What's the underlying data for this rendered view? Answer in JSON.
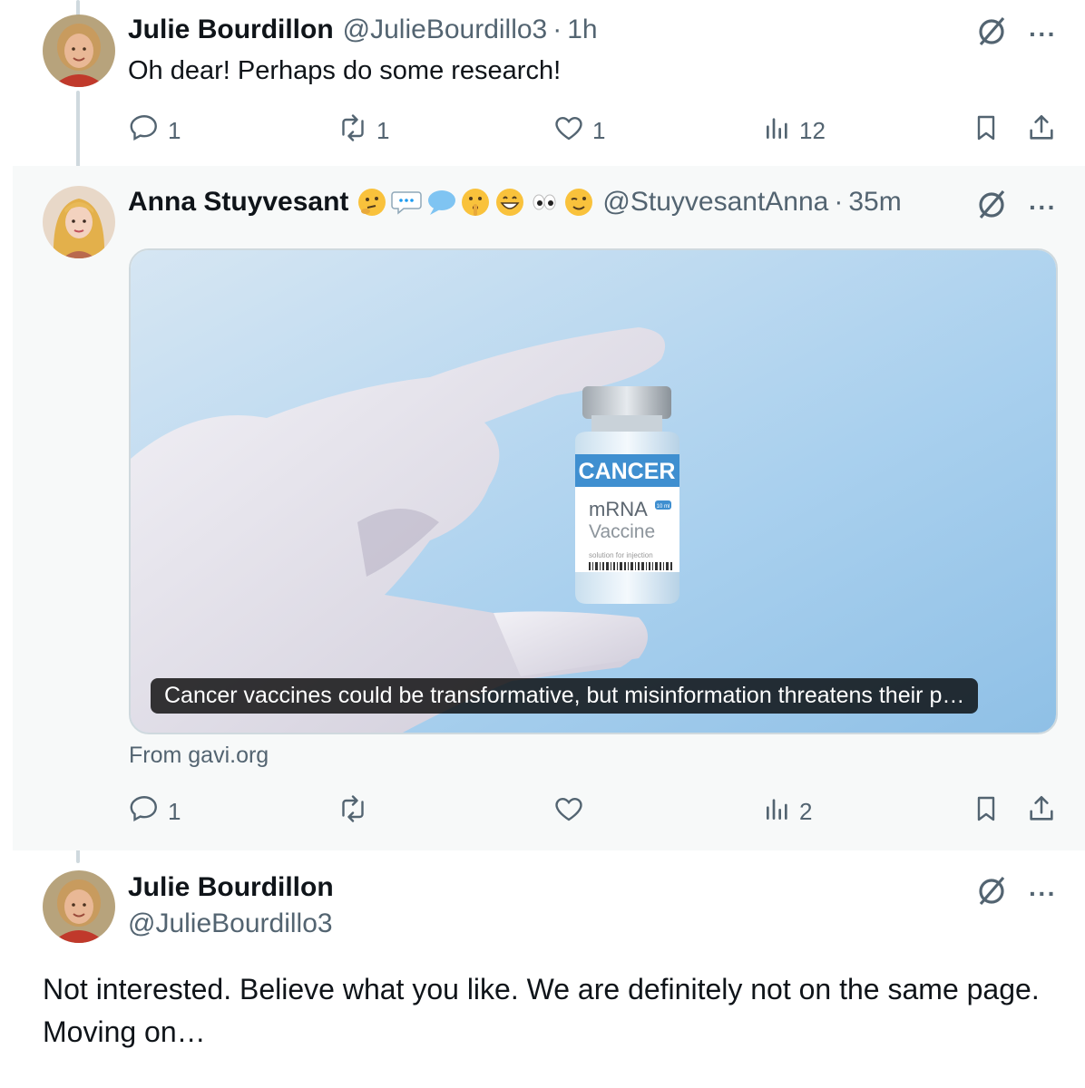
{
  "tweets": [
    {
      "name": "Julie Bourdillon",
      "handle": "@JulieBourdillo3",
      "time": "1h",
      "text": "Oh dear! Perhaps do some research!",
      "replies": "1",
      "reposts": "1",
      "likes": "1",
      "views": "12"
    },
    {
      "name": "Anna Stuyvesant",
      "emojis": [
        "thinking-face",
        "speech-bubble",
        "speech-bubble",
        "shushing-face",
        "grinning-face",
        "eyes",
        "winking-face"
      ],
      "handle": "@StuyvesantAnna",
      "time": "35m",
      "card": {
        "caption": "Cancer vaccines could be transformative, but misinformation threatens their p…",
        "source": "From gavi.org",
        "vial_band": "CANCER",
        "vial_line1": "mRNA",
        "vial_line2": "Vaccine",
        "vial_small": "solution for injection",
        "vial_tag": "10 ml"
      },
      "replies": "1",
      "reposts": "",
      "likes": "",
      "views": "2"
    },
    {
      "name": "Julie Bourdillon",
      "handle": "@JulieBourdillo3",
      "text": "Not interested. Believe what you like. We are definitely not on the same page. Moving on…"
    }
  ],
  "more_label": "···",
  "colors": {
    "accent": "#1d9bf0",
    "muted": "#536471",
    "highlight_bg": "#f7f9f9",
    "line": "#cfd9de"
  }
}
